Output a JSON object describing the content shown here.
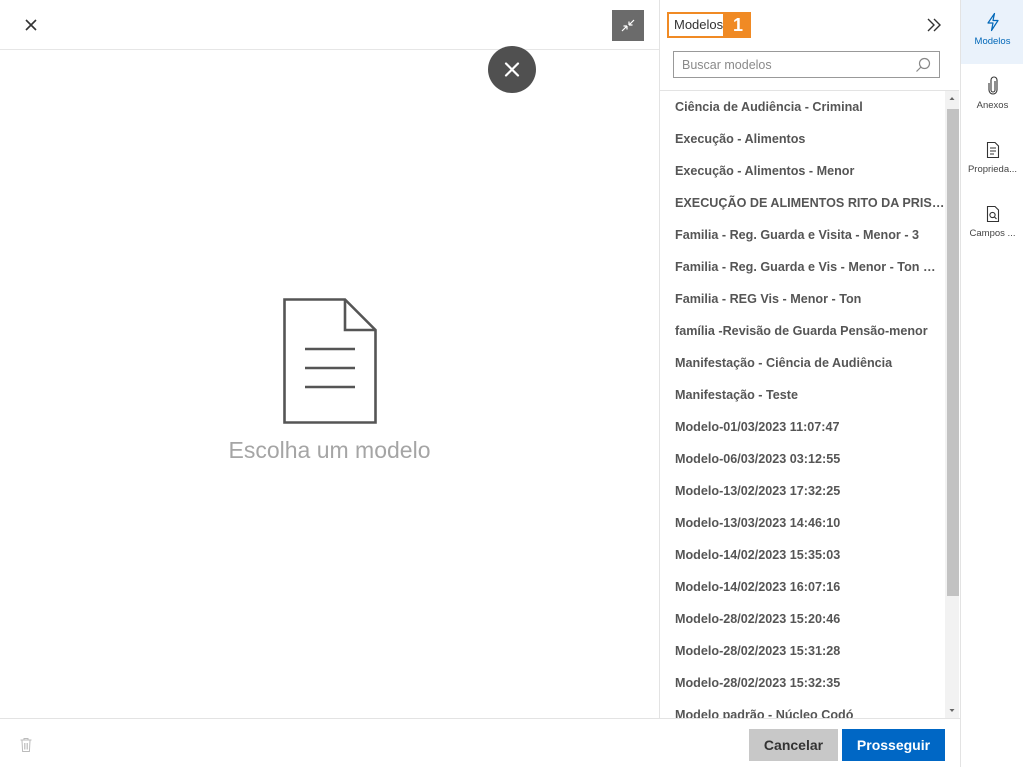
{
  "editor": {
    "empty_message": "Escolha um modelo",
    "close_icon": "close-icon",
    "collapse_icon": "collapse-icon"
  },
  "panel": {
    "title": "Modelos",
    "badge": "1",
    "search_placeholder": "Buscar modelos",
    "items": [
      "Ciência de Audiência - Criminal",
      "Execução - Alimentos",
      "Execução - Alimentos - Menor",
      "EXECUÇÃO DE ALIMENTOS RITO DA PRISÃO",
      "Familia - Reg. Guarda e Visita - Menor - 3",
      "Familia - Reg. Guarda e Vis - Menor - Ton Guei...",
      "Familia - REG Vis - Menor - Ton",
      "família -Revisão de Guarda Pensão-menor",
      "Manifestação - Ciência de Audiência",
      "Manifestação - Teste",
      "Modelo-01/03/2023 11:07:47",
      "Modelo-06/03/2023 03:12:55",
      "Modelo-13/02/2023 17:32:25",
      "Modelo-13/03/2023 14:46:10",
      "Modelo-14/02/2023 15:35:03",
      "Modelo-14/02/2023 16:07:16",
      "Modelo-28/02/2023 15:20:46",
      "Modelo-28/02/2023 15:31:28",
      "Modelo-28/02/2023 15:32:35",
      "Modelo padrão - Núcleo Codó"
    ]
  },
  "rail": {
    "items": [
      {
        "label": "Modelos",
        "icon": "lightning-icon"
      },
      {
        "label": "Anexos",
        "icon": "paperclip-icon"
      },
      {
        "label": "Proprieda...",
        "icon": "properties-icon"
      },
      {
        "label": "Campos ...",
        "icon": "fields-search-icon"
      }
    ]
  },
  "footer": {
    "cancel_label": "Cancelar",
    "ok_label": "Prosseguir"
  },
  "colors": {
    "accent_blue": "#0067c5",
    "highlight_orange": "#f08a24",
    "cancel_gray": "#c8c8c8"
  }
}
